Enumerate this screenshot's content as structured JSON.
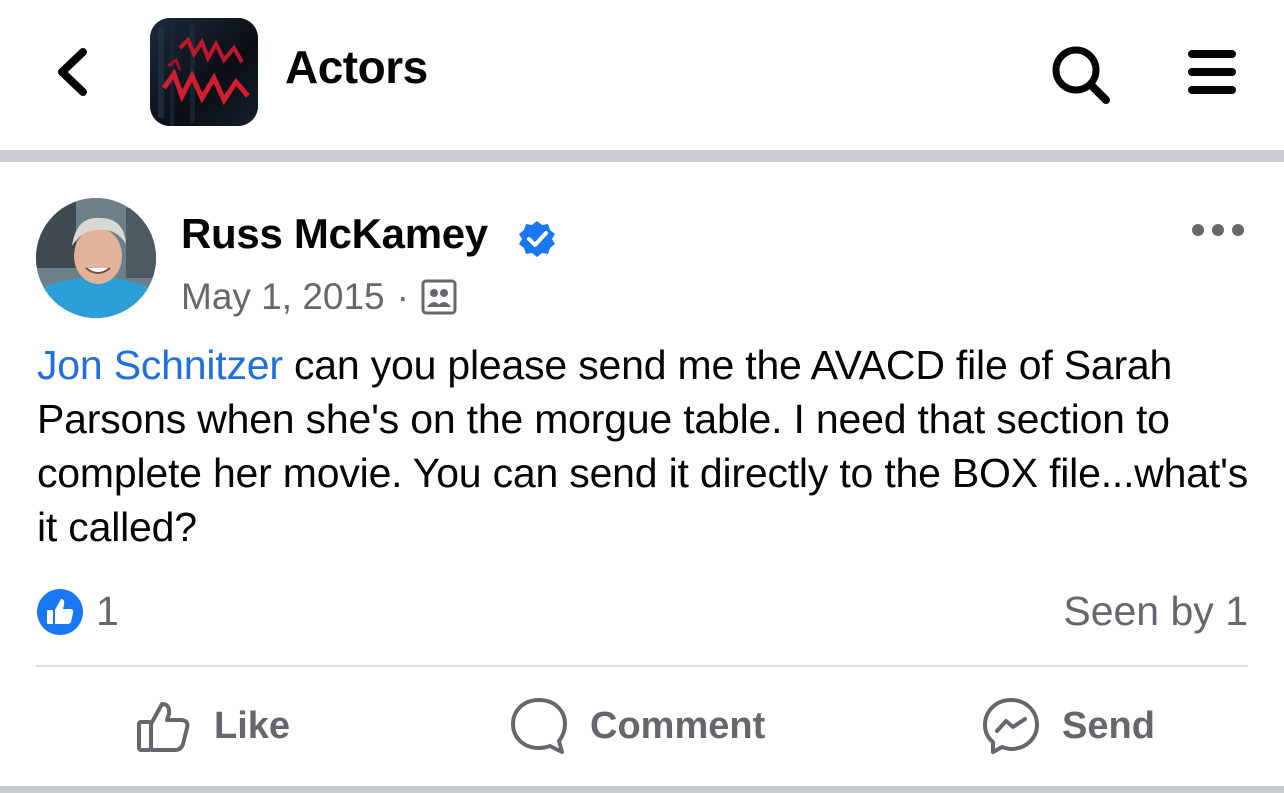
{
  "header": {
    "group_name": "Actors",
    "icons": {
      "back": "chevron-left-icon",
      "search": "search-icon",
      "menu": "hamburger-menu-icon"
    }
  },
  "post": {
    "author": "Russ McKamey",
    "date": "May 1, 2015",
    "separator": "·",
    "audience_icon": "group-audience-icon",
    "mention": "Jon Schnitzer",
    "body": " can you please send me the AVACD file of Sarah Parsons when she's on the morgue table. I need that section to complete her movie.  You can send it directly to the BOX file...what's it called?",
    "reaction_count": "1",
    "seen_by": "Seen by 1"
  },
  "actions": {
    "like": "Like",
    "comment": "Comment",
    "send": "Send"
  },
  "colors": {
    "link_blue": "#216fdb",
    "like_blue": "#1877f2",
    "secondary_text": "#65676b",
    "divider": "#c9ccd1"
  }
}
